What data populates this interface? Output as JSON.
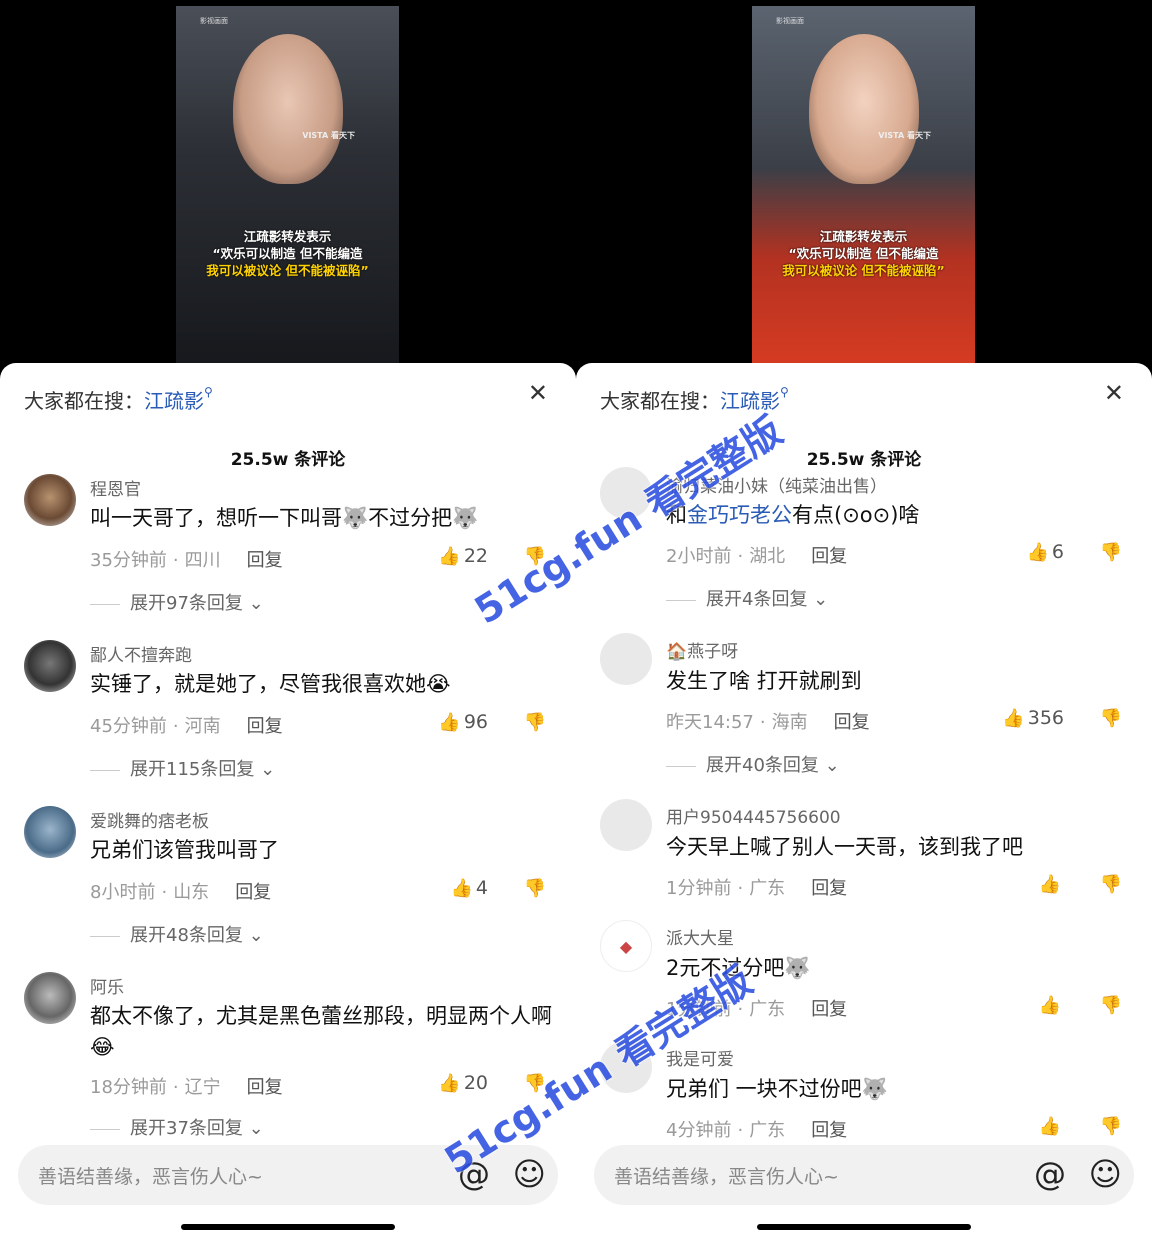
{
  "panels": [
    {
      "video": {
        "watermark": "影视画面",
        "logo": "VISTA 看天下",
        "caption_line1": "江疏影转发表示",
        "caption_line2": "“欢乐可以制造 但不能编造",
        "caption_line3": "我可以被议论 但不能被诬陷”"
      },
      "search_prefix": "大家都在搜：",
      "search_keyword": "江疏影",
      "comment_count": "25.5w 条评论",
      "comments": [
        {
          "name": "程恩官",
          "text": "叫一天哥了，想听一下叫哥🐺不过分把🐺",
          "time": "35分钟前",
          "location": "四川",
          "reply": "回复",
          "likes": "22",
          "expand": "展开97条回复"
        },
        {
          "name": "鄙人不擅奔跑",
          "text": "实锤了，就是她了，尽管我很喜欢她😭",
          "time": "45分钟前",
          "location": "河南",
          "reply": "回复",
          "likes": "96",
          "expand": "展开115条回复"
        },
        {
          "name": "爱跳舞的痞老板",
          "text": "兄弟们该管我叫哥了",
          "time": "8小时前",
          "location": "山东",
          "reply": "回复",
          "likes": "4",
          "expand": "展开48条回复"
        },
        {
          "name": "阿乐",
          "text": "都太不像了，尤其是黑色蕾丝那段，明显两个人啊😂",
          "time": "18分钟前",
          "location": "辽宁",
          "reply": "回复",
          "likes": "20",
          "expand": "展开37条回复"
        }
      ],
      "composer_placeholder": "善语结善缘，恶言伤人心~"
    },
    {
      "video": {
        "watermark": "影视画面",
        "logo": "VISTA 看天下",
        "caption_line1": "江疏影转发表示",
        "caption_line2": "“欢乐可以制造 但不能编造",
        "caption_line3": "我可以被议论 但不能被诬陷”"
      },
      "search_prefix": "大家都在搜：",
      "search_keyword": "江疏影",
      "comment_count": "25.5w 条评论",
      "comments": [
        {
          "name": "渝归菜油小妹（纯菜油出售）",
          "text_prefix": "和",
          "text_link": "金巧巧老公",
          "text_suffix": "有点(⊙o⊙)啥",
          "time": "2小时前",
          "location": "湖北",
          "reply": "回复",
          "likes": "6",
          "expand": "展开4条回复"
        },
        {
          "name": "🏠燕子呀",
          "text": "发生了啥 打开就刷到",
          "time": "昨天14:57",
          "location": "海南",
          "reply": "回复",
          "likes": "356",
          "expand": "展开40条回复"
        },
        {
          "name": "用户9504445756600",
          "text": "今天早上喊了别人一天哥，该到我了吧",
          "time": "1分钟前",
          "location": "广东",
          "reply": "回复",
          "likes": ""
        },
        {
          "name": "派大大星",
          "text": "2元不过分吧🐺",
          "time": "1分钟前",
          "location": "广东",
          "reply": "回复",
          "likes": ""
        },
        {
          "name": "我是可爱",
          "text": "兄弟们 一块不过份吧🐺",
          "time": "4分钟前",
          "location": "广东",
          "reply": "回复",
          "likes": ""
        }
      ],
      "composer_placeholder": "善语结善缘，恶言伤人心~"
    }
  ],
  "overlay_watermark": "51cg.fun 看完整版",
  "icons": {
    "search": "search-icon",
    "close": "close-icon",
    "like": "thumbs-up-icon",
    "dislike": "thumbs-down-icon",
    "at": "at-icon",
    "emoji": "emoji-icon"
  },
  "colors": {
    "link": "#2a5bb5",
    "watermark": "#2c4fe0",
    "caption_highlight": "#ffd200"
  }
}
